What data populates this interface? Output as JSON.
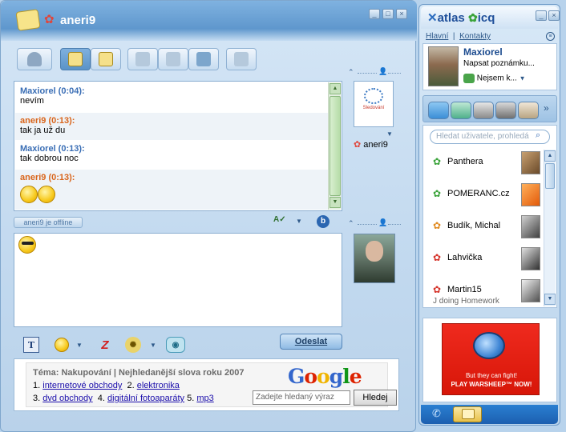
{
  "chat": {
    "title": "aneri9",
    "messages": [
      {
        "sender": "Maxiorel (0:04):",
        "text": "nevím",
        "color": "blue"
      },
      {
        "sender": "aneri9 (0:13):",
        "text": "tak ja už du",
        "color": "orange"
      },
      {
        "sender": "Maxiorel (0:13):",
        "text": "tak dobrou noc",
        "color": "blue"
      },
      {
        "sender": "aneri9 (0:13):",
        "text": "",
        "color": "orange"
      }
    ],
    "contact_name": "aneri9",
    "contact_avatar_label": "Sledování",
    "status_pill": "aneri9 je offline",
    "send_label": "Odeslat"
  },
  "ad": {
    "topic": "Téma: Nakupování | Nejhledanější slova roku 2007",
    "line1": [
      "1.",
      "internetové obchody",
      "2.",
      "elektronika"
    ],
    "line2": [
      "3.",
      "dvd obchody",
      "4.",
      "digitální fotoaparáty",
      "5.",
      "mp3"
    ],
    "google_logo": "Google",
    "search_placeholder": "Zadejte hledaný výraz",
    "search_button": "Hledej"
  },
  "contacts_window": {
    "brand": "atlas",
    "brand2": "icq",
    "nav": [
      "Hlavní",
      "Kontakty"
    ],
    "profile": {
      "name": "Maxiorel",
      "note": "Napsat poznámku...",
      "status": "Nejsem k..."
    },
    "search_placeholder": "Hledat uživatele, prohledá",
    "contacts": [
      {
        "name": "Panthera",
        "sub": ""
      },
      {
        "name": "POMERANC.cz",
        "sub": ""
      },
      {
        "name": "Budík, Michal",
        "sub": ""
      },
      {
        "name": "Lahvička",
        "sub": ""
      },
      {
        "name": "Martin15",
        "sub": "J doing Homework"
      }
    ],
    "banner": {
      "line1": "But they can fight!",
      "line2": "PLAY WARSHEEP™ NOW!"
    }
  },
  "colors": {
    "accent": "#5f97cd",
    "sender_blue": "#3a6eb5",
    "sender_orange": "#d9651c",
    "banner_red": "#e01e12"
  }
}
